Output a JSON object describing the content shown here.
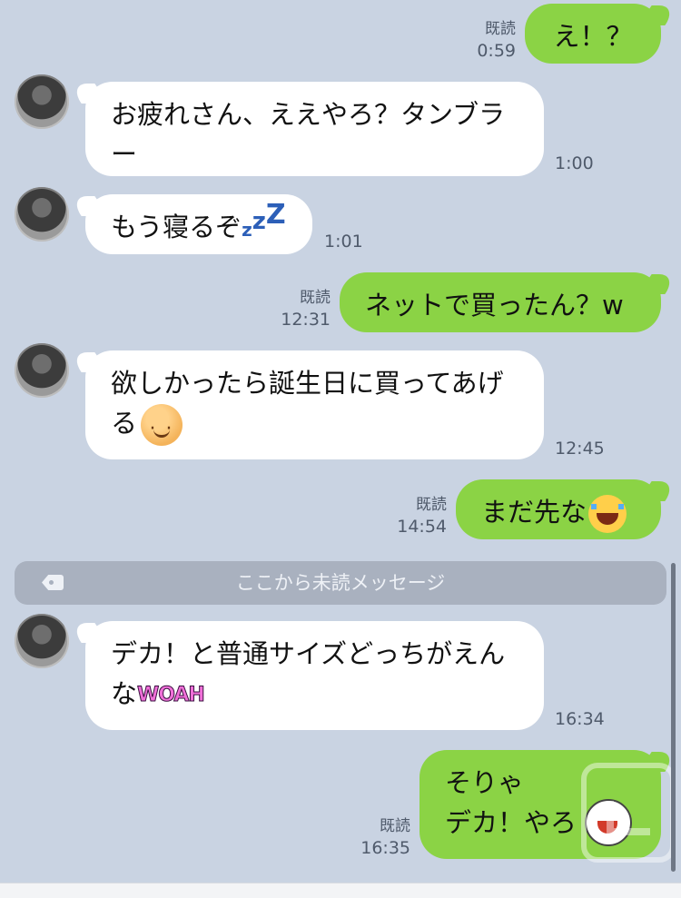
{
  "messages": [
    {
      "id": "m1",
      "side": "out",
      "text": "え！？",
      "read": "既読",
      "time": "0:59"
    },
    {
      "id": "m2",
      "side": "in",
      "line1": "お疲れさん、ええやろ？タンブラ",
      "line2": "ー",
      "time": "1:00"
    },
    {
      "id": "m3",
      "side": "in",
      "line1": "もう寝るぞ",
      "emoji": "zzz",
      "time": "1:01"
    },
    {
      "id": "m4",
      "side": "out",
      "text": "ネットで買ったん？w",
      "read": "既読",
      "time": "12:31"
    },
    {
      "id": "m5",
      "side": "in",
      "line1": "欲しかったら誕生日に買ってあげ",
      "line2": "る",
      "emoji": "smiling-face",
      "time": "12:45"
    },
    {
      "id": "m6",
      "side": "out",
      "text": "まだ先な",
      "emoji": "tears-of-joy",
      "read": "既読",
      "time": "14:54"
    },
    {
      "id": "m7",
      "side": "in",
      "line1": "デカ！と普通サイズどっちがえん",
      "line2": "な",
      "sticker_text": "WOAH",
      "time": "16:34"
    },
    {
      "id": "m8",
      "side": "out",
      "line1": "そりゃ",
      "line2": "デカ！やろ",
      "emoji": "laughing-sticker",
      "read": "既読",
      "time": "16:35"
    }
  ],
  "unread_divider": {
    "label": "ここから未読メッセージ",
    "icon": "tag-icon"
  },
  "colors": {
    "background": "#c9d3e2",
    "outgoing": "#8bd345",
    "incoming": "#ffffff",
    "divider": "#a9b1bf"
  }
}
